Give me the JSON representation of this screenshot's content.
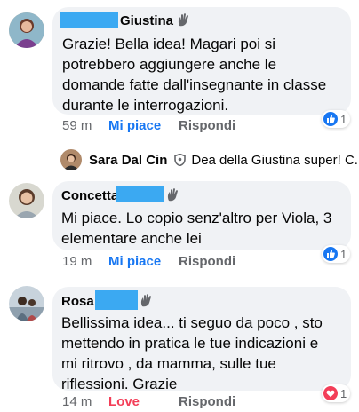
{
  "comments": [
    {
      "author": "Giustina",
      "text_lines": [
        "Grazie! Bella idea! Magari poi si",
        "potrebbero aggiungere anche le",
        "domande fatte dall'insegnante in classe",
        "durante le interrogazioni."
      ],
      "time": "59 m",
      "reaction_label": "Mi piace",
      "reply_label": "Rispondi",
      "reaction_icon": "like-icon",
      "reaction_count": "1"
    },
    {
      "author": "Concetta",
      "text_lines": [
        "Mi piace. Lo copio senz'altro per Viola, 3",
        "elementare anche lei"
      ],
      "time": "19 m",
      "reaction_label": "Mi piace",
      "reply_label": "Rispondi",
      "reaction_icon": "like-icon",
      "reaction_count": "1"
    },
    {
      "author": "Rosa",
      "text_lines": [
        "Bellissima idea... ti seguo da poco , sto",
        "mettendo in pratica le tue indicazioni e",
        "mi ritrovo , da mamma, sulle tue",
        "riflessioni.  Grazie"
      ],
      "time": "14 m",
      "reaction_label": "Love",
      "reply_label": "Rispondi",
      "reaction_icon": "love-icon",
      "reaction_count": "1"
    }
  ],
  "reply_preview": {
    "author": "Sara Dal Cin",
    "text": "Dea della Giustina super! C..."
  },
  "colors": {
    "bubble": "#f0f2f5",
    "like": "#1877f2",
    "love": "#f33e58",
    "redaction": "#3ba9f2",
    "meta": "#65676b"
  }
}
